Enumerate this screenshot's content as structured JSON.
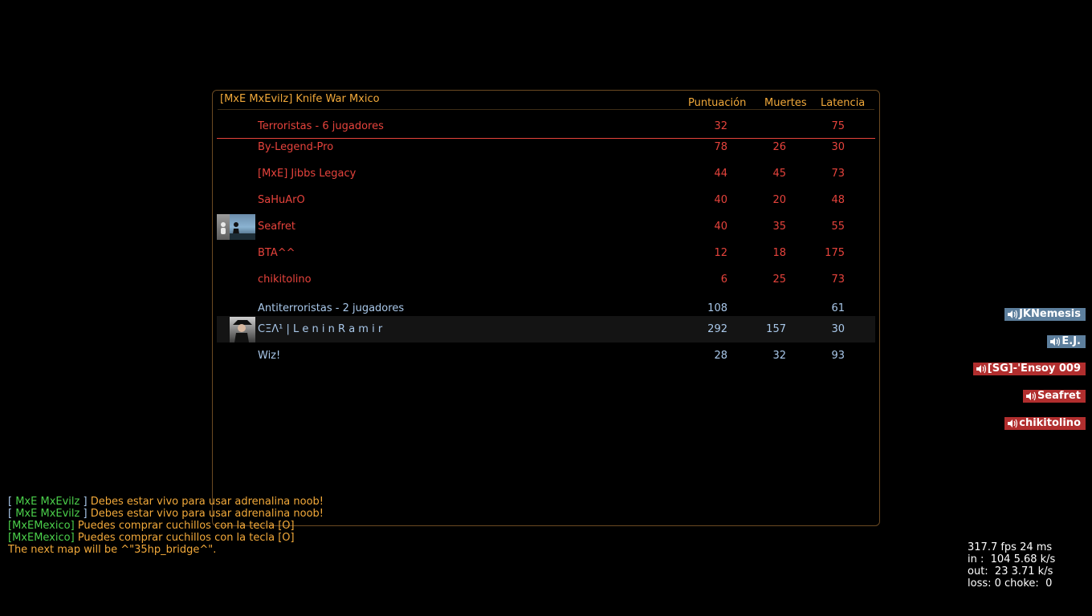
{
  "scoreboard": {
    "title": "[MxE MxEvilz] Knife War Mxico",
    "columns": {
      "score": "Puntuación",
      "deaths": "Muertes",
      "ping": "Latencia"
    },
    "teams": [
      {
        "name": "Terroristas    -   6 jugadores",
        "score": "32",
        "deaths": "",
        "ping": "75",
        "color": "#e6433c",
        "players": [
          {
            "name": "By-Legend-Pro",
            "score": "78",
            "deaths": "26",
            "ping": "30",
            "avatar": false
          },
          {
            "name": "[MxE] Jibbs Legacy",
            "score": "44",
            "deaths": "45",
            "ping": "73",
            "avatar": false
          },
          {
            "name": "SaHuArO",
            "score": "40",
            "deaths": "20",
            "ping": "48",
            "avatar": false
          },
          {
            "name": "Seafret",
            "score": "40",
            "deaths": "35",
            "ping": "55",
            "avatar": true
          },
          {
            "name": "BTA^^",
            "score": "12",
            "deaths": "18",
            "ping": "175",
            "avatar": false
          },
          {
            "name": "chikitolino",
            "score": "6",
            "deaths": "25",
            "ping": "73",
            "avatar": false
          }
        ]
      },
      {
        "name": "Antiterroristas   -   2 jugadores",
        "score": "108",
        "deaths": "",
        "ping": "61",
        "color": "#a9c8ea",
        "players": [
          {
            "name": "CΞΛ¹ | L e n i n   R a m i r",
            "score": "292",
            "deaths": "157",
            "ping": "30",
            "avatar": true,
            "highlight": true
          },
          {
            "name": "Wiz!",
            "score": "28",
            "deaths": "32",
            "ping": "93",
            "avatar": false
          }
        ]
      }
    ]
  },
  "voice": [
    {
      "name": "JKNemesis",
      "team": "blue"
    },
    {
      "name": "E.J.",
      "team": "blue"
    },
    {
      "name": "[SG]-'Ensoy 009",
      "team": "red"
    },
    {
      "name": "Seafret",
      "team": "red"
    },
    {
      "name": "chikitolino",
      "team": "red"
    }
  ],
  "chat": [
    {
      "prefix": "[ ",
      "tag": "MxE MxEvilz",
      "suffix": " ] ",
      "msg": "Debes estar vivo para usar adrenalina noob!"
    },
    {
      "prefix": "[ ",
      "tag": "MxE MxEvilz",
      "suffix": " ] ",
      "msg": "Debes estar vivo para usar adrenalina noob!"
    },
    {
      "prefix": "",
      "tag": "[MxEMexico]",
      "suffix": " ",
      "msg": "Puedes comprar cuchillos con la tecla [O]"
    },
    {
      "prefix": "",
      "tag": "[MxEMexico]",
      "suffix": " ",
      "msg": "Puedes comprar cuchillos con la tecla [O]"
    },
    {
      "prefix": "",
      "tag": "",
      "suffix": "",
      "msg": "The next map will be ^\"35hp_bridge^\"."
    }
  ],
  "netgraph": [
    "317.7 fps 24 ms",
    "in :  104 5.68 k/s",
    "out:  23 3.71 k/s",
    "loss: 0 choke:  0"
  ]
}
